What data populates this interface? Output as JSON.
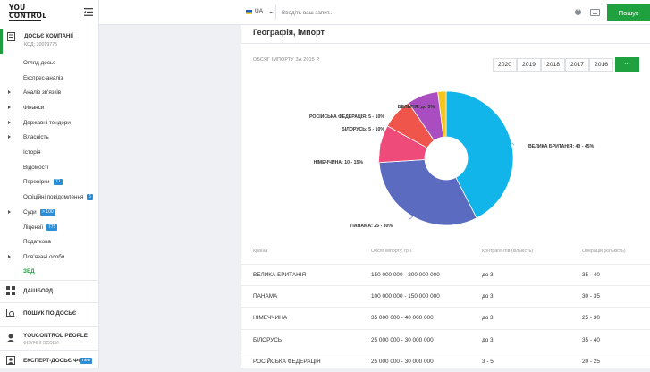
{
  "logo": {
    "line1": "YOU",
    "line2": "CONTROL"
  },
  "sidebar": {
    "dossier": {
      "title": "ДОСЬЄ КОМПАНІЇ",
      "code": "КОД: 30019775"
    },
    "items": [
      {
        "label": "Огляд досьє",
        "arrow": false
      },
      {
        "label": "Експрес-аналіз",
        "arrow": false
      },
      {
        "label": "Аналіз зв'язків",
        "arrow": true
      },
      {
        "label": "Фінанси",
        "arrow": true
      },
      {
        "label": "Державні тендери",
        "arrow": true
      },
      {
        "label": "Власність",
        "arrow": true
      },
      {
        "label": "Історія",
        "arrow": false
      },
      {
        "label": "Відомості",
        "arrow": false
      },
      {
        "label": "Перевірки",
        "arrow": false,
        "badge": "71"
      },
      {
        "label": "Офіційні повідомлення",
        "arrow": false,
        "badge": "6"
      },
      {
        "label": "Суди",
        "arrow": true,
        "badge": "> 100"
      },
      {
        "label": "Ліцензії",
        "arrow": false,
        "badge": "775"
      },
      {
        "label": "Податкова",
        "arrow": false
      },
      {
        "label": "Пов'язані особи",
        "arrow": true
      },
      {
        "label": "ЗЕД",
        "arrow": false,
        "active": true
      }
    ],
    "sections": [
      {
        "title": "ДАШБОРД"
      },
      {
        "title": "ПОШУК ПО ДОСЬЄ"
      },
      {
        "title": "YOUCONTROL PEOPLE",
        "sub": "ФІЗИЧНІ ОСОБИ"
      },
      {
        "title": "ЕКСПЕРТ-ДОСЬЄ ФО",
        "badge": "new"
      }
    ]
  },
  "topbar": {
    "lang": "UA",
    "search_placeholder": "Введіть ваш запит...",
    "help": "?",
    "search_button": "Пошук"
  },
  "panel": {
    "title": "Географія, імпорт",
    "volume_label": "ОБСЯГ ІМПОРТУ ЗА 2015 Р.",
    "years": [
      "2020",
      "2019",
      "2018",
      "2017",
      "2016"
    ],
    "more": "..."
  },
  "chart_data": {
    "type": "pie",
    "donut": true,
    "slices": [
      {
        "label": "ВЕЛИКА БРИТАНІЯ: 40 - 45%",
        "value": 42.5,
        "color": "#12b5ea"
      },
      {
        "label": "ПАНАМА: 25 - 30%",
        "value": 31.5,
        "color": "#5b6bbf"
      },
      {
        "label": "НІМЕЧЧИНА: 10 - 15%",
        "value": 9,
        "color": "#ee4a7a"
      },
      {
        "label": "БІЛОРУСЬ: 5 - 10%",
        "value": 7.5,
        "color": "#f0554c"
      },
      {
        "label": "РОСІЙСЬКА ФЕДЕРАЦІЯ: 5 - 10%",
        "value": 7.5,
        "color": "#a94dc0"
      },
      {
        "label": "БЕЛЬГІЯ: до 3%",
        "value": 2,
        "color": "#f5c518"
      }
    ]
  },
  "table": {
    "headers": [
      "Країна",
      "Обсяг імпорту, грн.",
      "Контрагентів (кількість)",
      "Операцій (кількість)"
    ],
    "rows": [
      [
        "ВЕЛИКА БРИТАНІЯ",
        "150 000 000 - 200 000 000",
        "до 3",
        "35 - 40"
      ],
      [
        "ПАНАМА",
        "100 000 000 - 150 000 000",
        "до 3",
        "30 - 35"
      ],
      [
        "НІМЕЧЧИНА",
        "35 000 000 - 40 000 000",
        "до 3",
        "25 - 30"
      ],
      [
        "БІЛОРУСЬ",
        "25 000 000 - 30 000 000",
        "до 3",
        "35 - 40"
      ],
      [
        "РОСІЙСЬКА ФЕДЕРАЦІЯ",
        "25 000 000 - 30 000 000",
        "3 - 5",
        "20 - 25"
      ]
    ]
  },
  "colors": {
    "accent": "#1ea13e",
    "badge": "#2a8fd6"
  }
}
